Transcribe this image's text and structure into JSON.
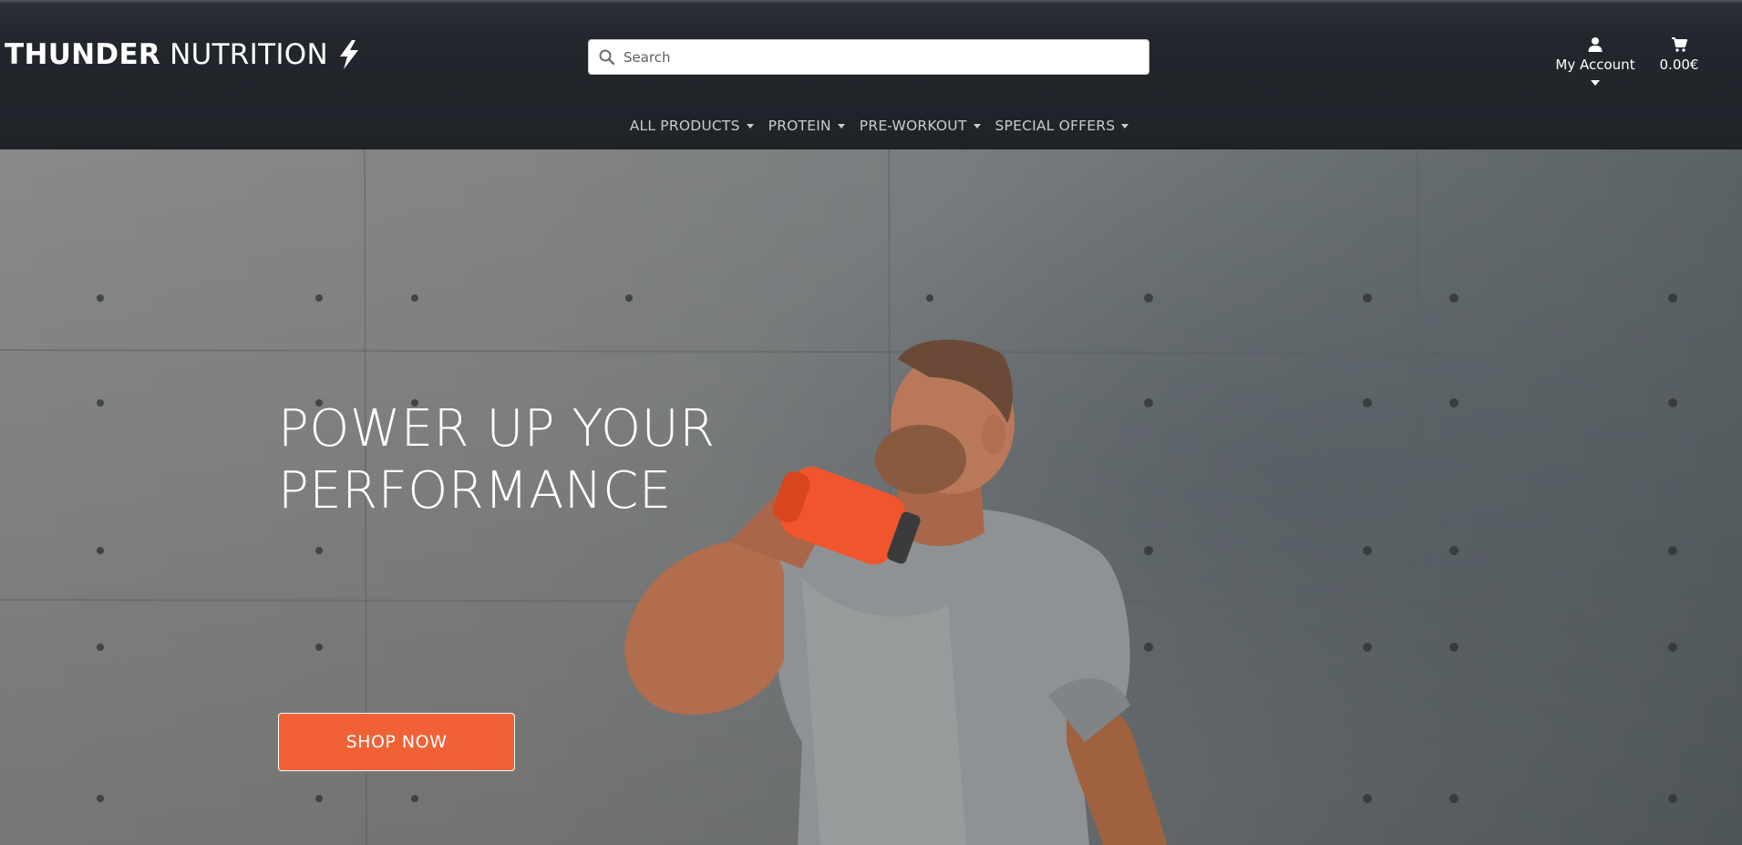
{
  "header": {
    "logo": {
      "bold": "THUNDER",
      "light": "NUTRITION",
      "icon": "lightning-bolt-icon"
    },
    "search": {
      "placeholder": "Search",
      "value": "",
      "icon": "search-icon"
    },
    "account": {
      "label": "My Account",
      "icon": "user-icon"
    },
    "cart": {
      "total": "0.00€",
      "icon": "shopping-cart-icon"
    }
  },
  "nav": {
    "items": [
      {
        "label": "ALL PRODUCTS"
      },
      {
        "label": "PROTEIN"
      },
      {
        "label": "PRE-WORKOUT"
      },
      {
        "label": "SPECIAL OFFERS"
      }
    ]
  },
  "hero": {
    "title_line1": "POWER UP YOUR",
    "title_line2": "PERFORMANCE",
    "cta_label": "SHOP NOW",
    "image": "athlete-drinking-from-orange-shaker"
  },
  "colors": {
    "header_bg": "#23272d",
    "accent": "#f06236",
    "nav_text": "#c8ccd1",
    "shaker": "#f0552e"
  }
}
